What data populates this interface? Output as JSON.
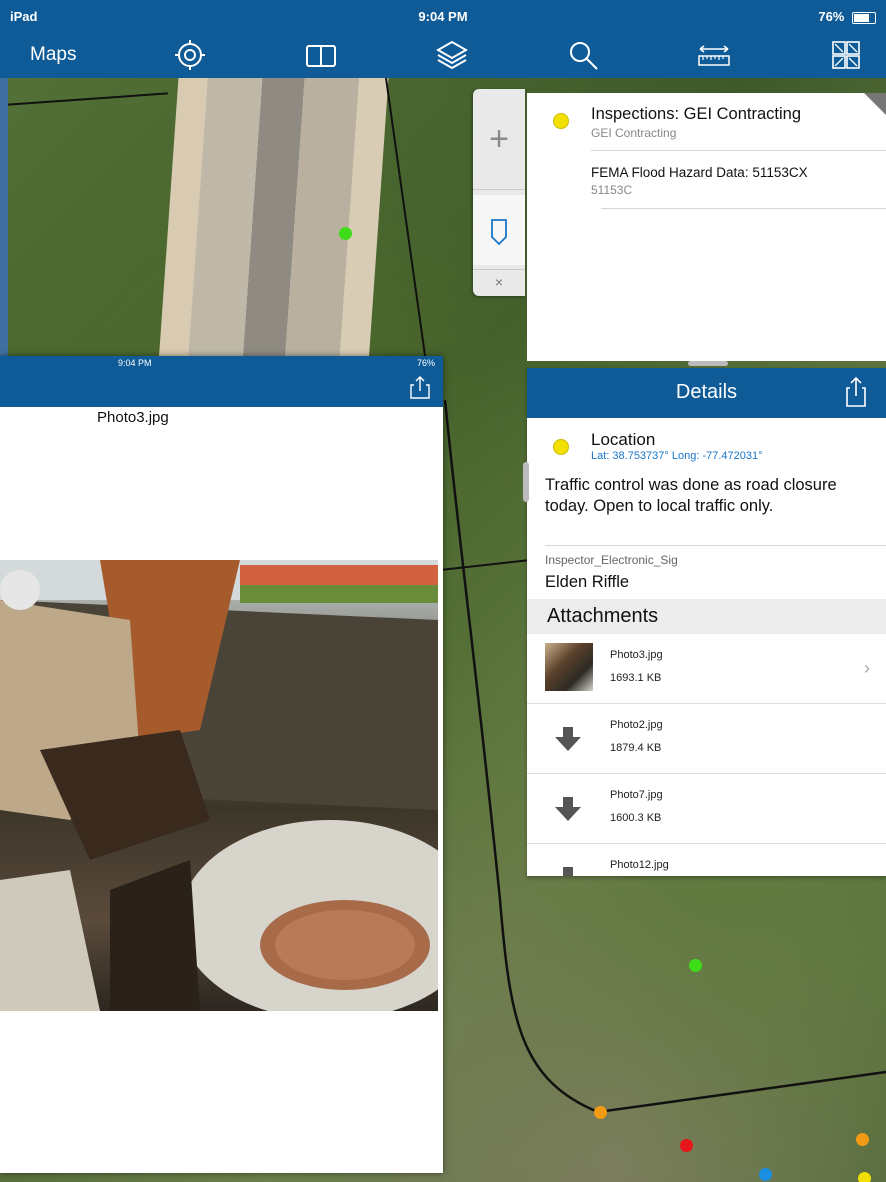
{
  "status_bar": {
    "device": "iPad",
    "time": "9:04 PM",
    "battery": "76%"
  },
  "toolbar": {
    "maps_label": "Maps",
    "icons": [
      "locate-icon",
      "book-icon",
      "layers-icon",
      "search-icon",
      "measure-icon",
      "qr-icon"
    ]
  },
  "photo_viewer": {
    "status_time": "9:04 PM",
    "status_battery": "76%",
    "title": "Photo3.jpg"
  },
  "results": {
    "items": [
      {
        "title": "Inspections: GEI Contracting",
        "subtitle": "GEI Contracting"
      },
      {
        "title": "FEMA Flood Hazard Data: 51153CX",
        "subtitle": "51153C"
      }
    ]
  },
  "details": {
    "header": "Details",
    "location_title": "Location",
    "location_coords": "Lat: 38.753737° Long: -77.472031°",
    "description": "Traffic control was done as road closure today. Open to local traffic only.",
    "inspector_label": "Inspector_Electronic_Sig",
    "inspector_value": "Elden Riffle",
    "attachments_header": "Attachments",
    "attachments": [
      {
        "name": "Photo3.jpg",
        "size": "1693.1 KB"
      },
      {
        "name": "Photo2.jpg",
        "size": "1879.4 KB"
      },
      {
        "name": "Photo7.jpg",
        "size": "1600.3 KB"
      },
      {
        "name": "Photo12.jpg",
        "size": ""
      }
    ]
  },
  "colors": {
    "brand": "#0e5b98",
    "marker_yellow": "#f1e000",
    "link": "#1a76c8"
  }
}
